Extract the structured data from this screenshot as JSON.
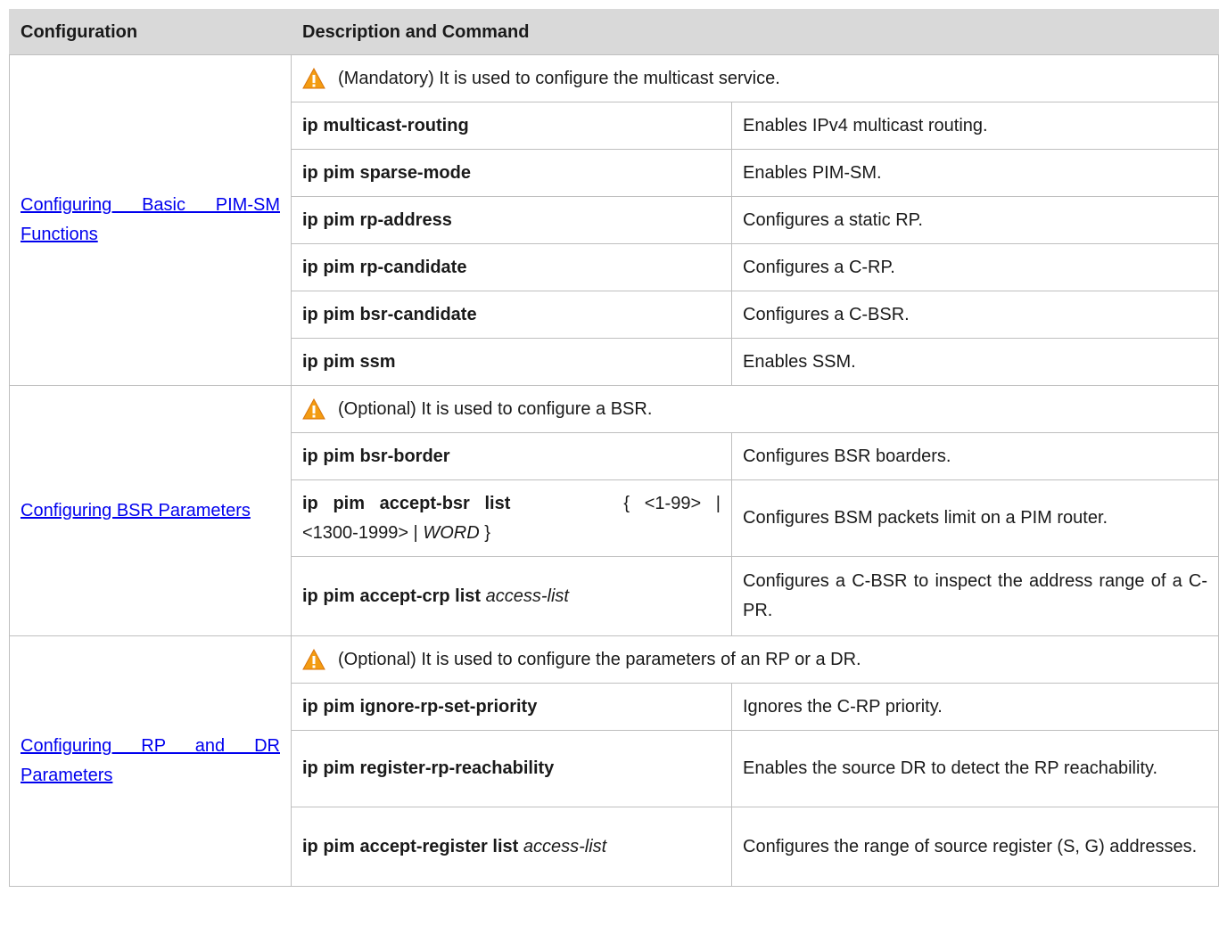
{
  "header": {
    "configuration": "Configuration",
    "description": "Description and Command"
  },
  "sections": [
    {
      "config_line1": "Configuring Basic PIM-SM",
      "config_line2": "Functions",
      "note": "(Mandatory) It is used to configure the multicast service.",
      "rows": [
        {
          "cmd": "ip multicast-routing",
          "desc": "Enables IPv4 multicast routing."
        },
        {
          "cmd": "ip pim sparse-mode",
          "desc": "Enables PIM-SM."
        },
        {
          "cmd": "ip pim rp-address",
          "desc": "Configures a static RP."
        },
        {
          "cmd": "ip pim rp-candidate",
          "desc": "Configures a C-RP."
        },
        {
          "cmd": "ip pim bsr-candidate",
          "desc": "Configures a C-BSR."
        },
        {
          "cmd": "ip pim ssm",
          "desc": "Enables SSM."
        }
      ]
    },
    {
      "config_line1": "Configuring BSR Parameters",
      "note": "(Optional) It is used to configure a BSR.",
      "rows": [
        {
          "cmd": "ip pim bsr-border",
          "desc": "Configures BSR boarders."
        },
        {
          "cmd": "ip   pim   accept-bsr   list",
          "cmd_tail_1": "{   <1-99>   |",
          "cmd_tail_2": "<1300-1999> | ",
          "cmd_arg": "WORD",
          "cmd_tail_3": " }",
          "desc": "Configures BSM packets limit on a PIM router."
        },
        {
          "cmd": "ip pim accept-crp list ",
          "cmd_arg": "access-list",
          "desc": "Configures a C-BSR to inspect the address range of a C-PR."
        }
      ]
    },
    {
      "config_line1": "Configuring RP and DR",
      "config_line2": "Parameters",
      "note": "(Optional) It is used to configure the parameters of an RP or a DR.",
      "rows": [
        {
          "cmd": "ip pim ignore-rp-set-priority",
          "desc": "Ignores the C-RP priority."
        },
        {
          "cmd": "ip pim register-rp-reachability",
          "desc": "Enables the source DR to detect the RP reachability."
        },
        {
          "cmd": "ip pim accept-register list ",
          "cmd_arg": "access-list",
          "desc": "Configures the range of source register (S, G) addresses."
        }
      ]
    }
  ],
  "icons": {
    "warning": "warning-icon"
  },
  "colors": {
    "link": "#0000ee",
    "header_bg": "#d9d9d9",
    "warning_fill": "#f39c12"
  }
}
